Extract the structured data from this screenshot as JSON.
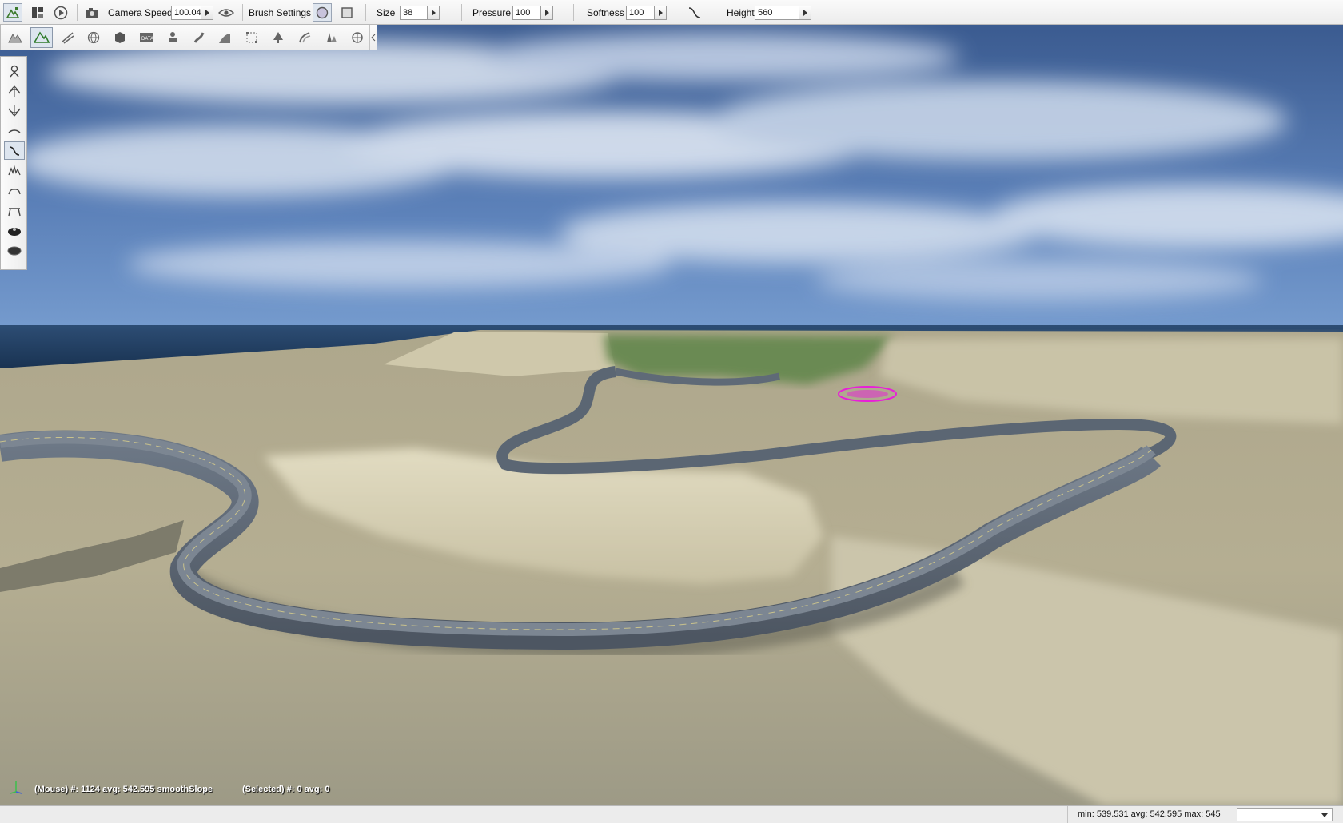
{
  "toolbar": {
    "camera_speed_label": "Camera Speed",
    "camera_speed_value": "100.04",
    "brush_settings_label": "Brush Settings",
    "size_label": "Size",
    "size_value": "38",
    "pressure_label": "Pressure",
    "pressure_value": "100",
    "softness_label": "Softness",
    "softness_value": "100",
    "height_label": "Height",
    "height_value": "560",
    "icons": [
      "terrain-editor-icon",
      "layout-icon",
      "play-icon",
      "camera-icon",
      "eye-icon",
      "circle-brush-icon",
      "square-brush-icon",
      "falloff-curve-icon"
    ]
  },
  "tools_row": {
    "icons": [
      "terrain-icon",
      "terrain-paint-icon",
      "road-icon",
      "globe-icon",
      "object-icon",
      "data-icon",
      "spawn-icon",
      "river-icon",
      "ramp-icon",
      "bounds-icon",
      "forest-icon",
      "decal-road-icon",
      "mesh-road-icon",
      "shape-icon"
    ],
    "active_index": 1
  },
  "brush_panel": {
    "icons": [
      "grab-brush-icon",
      "raise-brush-icon",
      "lower-brush-icon",
      "smooth-brush-icon",
      "smooth-slope-icon",
      "noise-brush-icon",
      "flatten-brush-icon",
      "set-height-icon",
      "clear-terrain-icon",
      "restore-terrain-icon"
    ],
    "active_index": 4
  },
  "viewport": {
    "mouse_info": "(Mouse) #: 1124  avg: 542.595 smoothSlope",
    "selected_info": "(Selected) #: 0  avg: 0"
  },
  "status_bar": {
    "stats": "min: 539.531  avg: 542.595  max: 545",
    "dropdown_value": ""
  },
  "colors": {
    "sky_top": "#3d5f96",
    "sky_horizon": "#6e95c9",
    "sea": "#1e3a5c",
    "terrain": "#b2aa8c",
    "road": "#5b6673",
    "brush_cursor": "#e81fd8"
  }
}
